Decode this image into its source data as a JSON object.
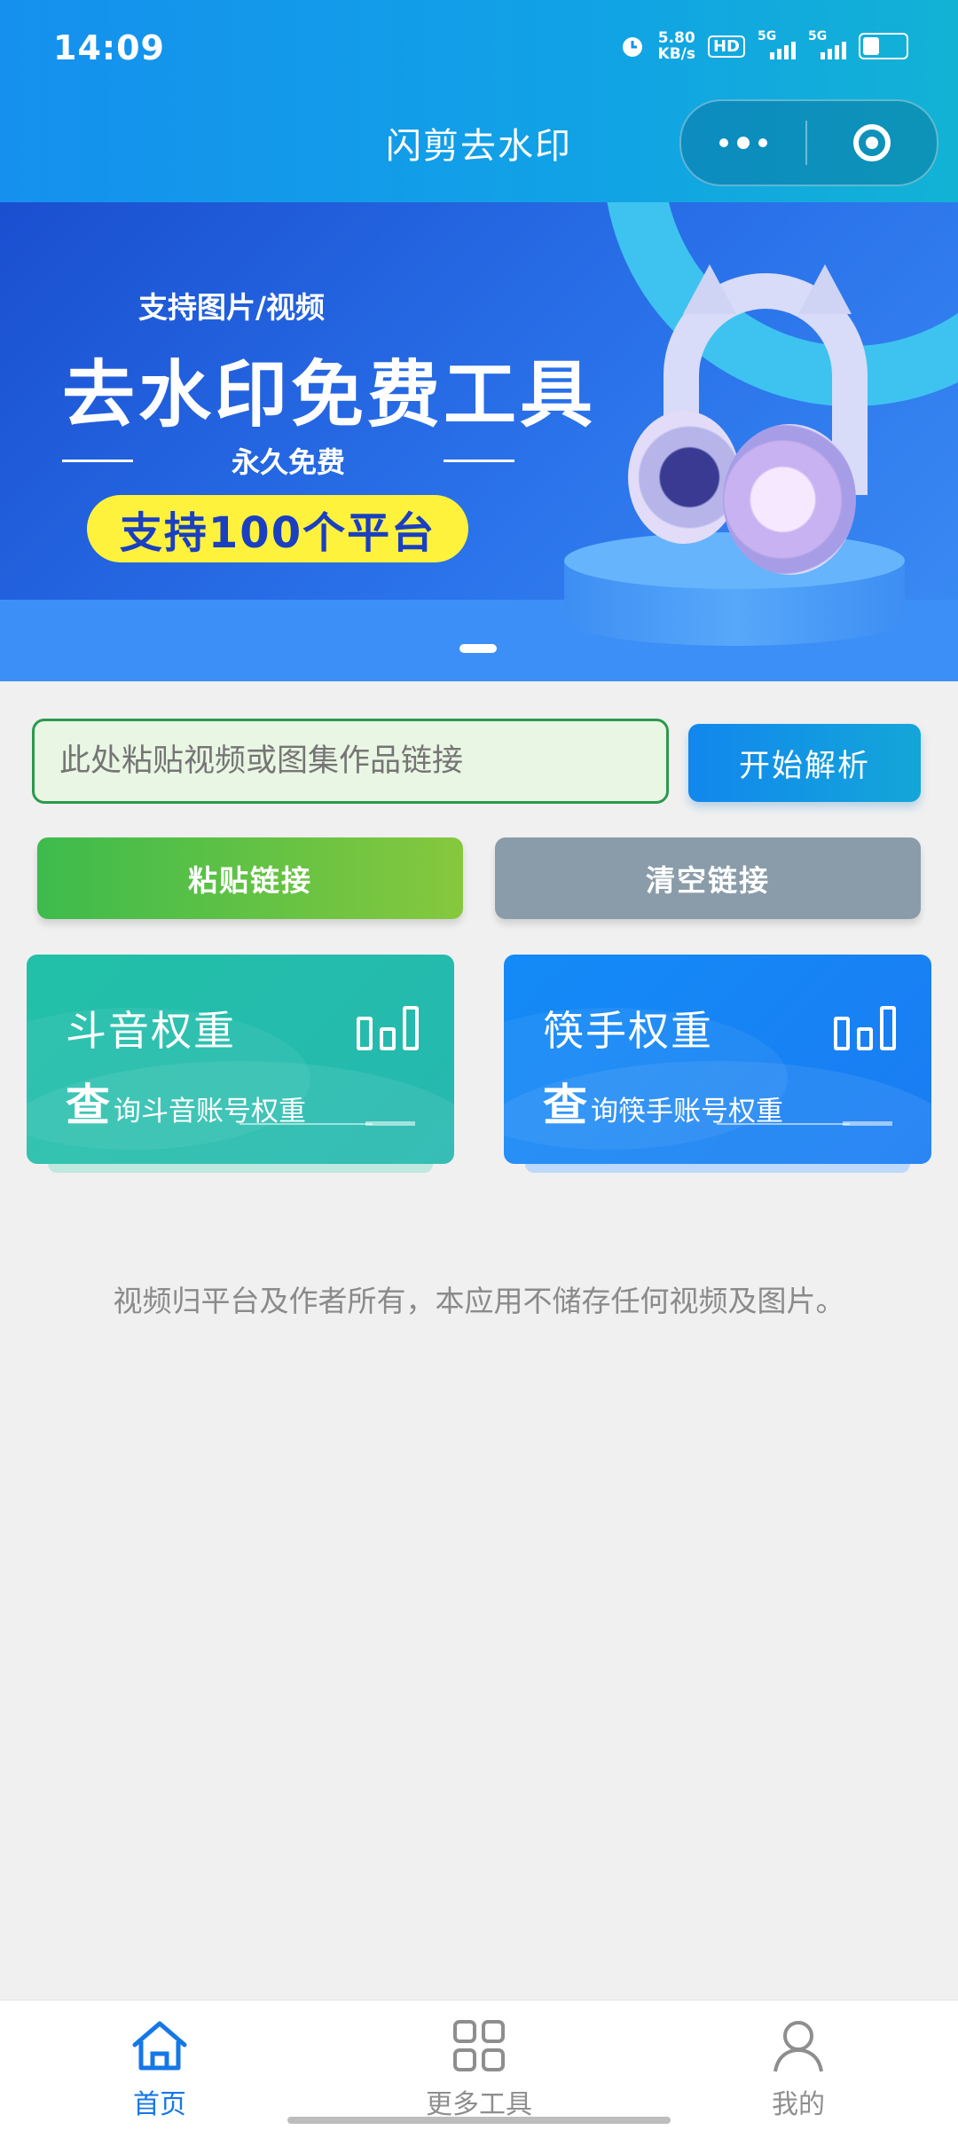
{
  "status_bar": {
    "time": "14:09",
    "net_speed_value": "5.80",
    "net_speed_unit": "KB/s",
    "hd_label": "HD",
    "sim1_label": "5G",
    "sim2_label": "5G",
    "battery_level": 0.35
  },
  "nav": {
    "title": "闪剪去水印"
  },
  "banner": {
    "subtitle": "支持图片/视频",
    "headline": "去水印免费工具",
    "free_text": "永久免费",
    "platform_badge": "支持100个平台",
    "page_count": 1,
    "active_page": 0
  },
  "input": {
    "placeholder": "此处粘贴视频或图集作品链接",
    "value": ""
  },
  "buttons": {
    "parse": "开始解析",
    "paste": "粘贴链接",
    "clear": "清空链接"
  },
  "cards": [
    {
      "title": "斗音权重",
      "sub_first": "查",
      "sub_rest": "询斗音账号权重"
    },
    {
      "title": "筷手权重",
      "sub_first": "查",
      "sub_rest": "询筷手账号权重"
    }
  ],
  "disclaimer": "视频归平台及作者所有，本应用不储存任何视频及图片。",
  "tabbar": {
    "items": [
      {
        "label": "首页",
        "icon": "home-icon",
        "active": true
      },
      {
        "label": "更多工具",
        "icon": "grid-icon",
        "active": false
      },
      {
        "label": "我的",
        "icon": "user-icon",
        "active": false
      }
    ]
  },
  "colors": {
    "header": "#1590ee",
    "accent_blue": "#1677e6",
    "paste_green": "#3dbb4c",
    "clear_gray": "#8a9ca9",
    "douyin_card": "#22c0a8",
    "kuaishou_card": "#138bf7",
    "badge_yellow": "#fff23d"
  }
}
